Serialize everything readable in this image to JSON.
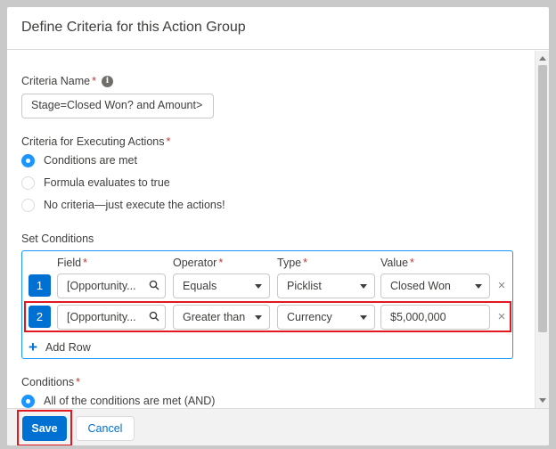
{
  "dialog": {
    "title": "Define Criteria for this Action Group"
  },
  "criteria_name": {
    "label": "Criteria Name",
    "required_mark": "*",
    "info_icon": "info-icon",
    "value": "Stage=Closed Won? and Amount>"
  },
  "executing": {
    "label": "Criteria for Executing Actions",
    "required_mark": "*",
    "options": [
      {
        "label": "Conditions are met",
        "selected": true
      },
      {
        "label": "Formula evaluates to true",
        "selected": false
      },
      {
        "label": "No criteria—just execute the actions!",
        "selected": false
      }
    ]
  },
  "set_conditions": {
    "label": "Set Conditions",
    "columns": [
      {
        "label": "Field",
        "required_mark": "*"
      },
      {
        "label": "Operator",
        "required_mark": "*"
      },
      {
        "label": "Type",
        "required_mark": "*"
      },
      {
        "label": "Value",
        "required_mark": "*"
      }
    ],
    "rows": [
      {
        "number": "1",
        "field": "[Opportunity...",
        "operator": "Equals",
        "type": "Picklist",
        "value": "Closed Won"
      },
      {
        "number": "2",
        "field": "[Opportunity...",
        "operator": "Greater than",
        "type": "Currency",
        "value": "$5,000,000"
      }
    ],
    "add_row_label": "Add Row"
  },
  "conditions": {
    "label": "Conditions",
    "required_mark": "*",
    "selected_option": "All of the conditions are met (AND)"
  },
  "footer": {
    "save_label": "Save",
    "cancel_label": "Cancel"
  },
  "colors": {
    "brand": "#0070d2",
    "highlight": "#e3171f",
    "radio_selected": "#1b96ff"
  }
}
